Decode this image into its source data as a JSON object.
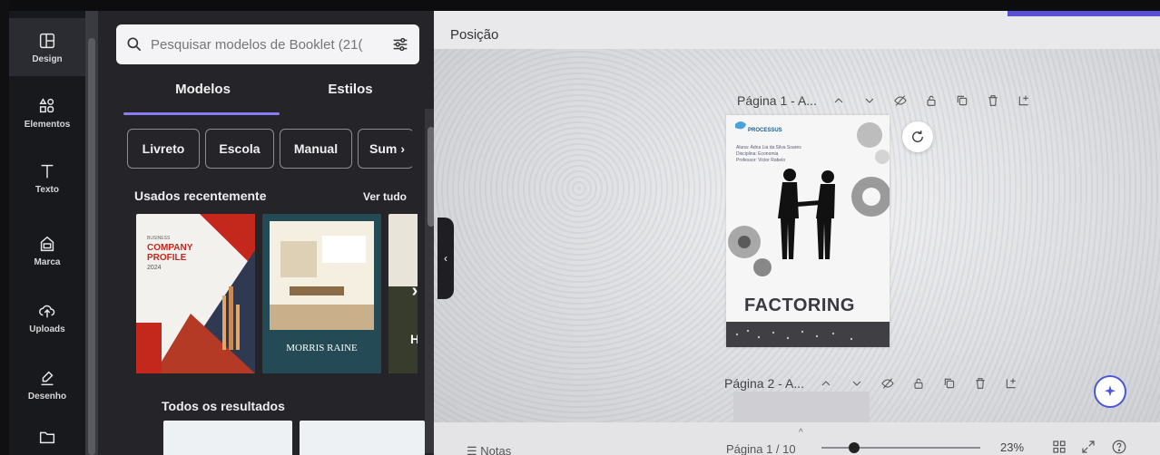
{
  "rail": {
    "items": [
      {
        "label": "Design",
        "icon": "layout-icon"
      },
      {
        "label": "Elementos",
        "icon": "shapes-icon"
      },
      {
        "label": "Texto",
        "icon": "text-icon"
      },
      {
        "label": "Marca",
        "icon": "brand-icon"
      },
      {
        "label": "Uploads",
        "icon": "upload-icon"
      },
      {
        "label": "Desenho",
        "icon": "draw-icon"
      }
    ]
  },
  "panel": {
    "search_placeholder": "Pesquisar modelos de Booklet (21(",
    "tabs": [
      "Modelos",
      "Estilos"
    ],
    "chips": [
      "Livreto",
      "Escola",
      "Manual",
      "Sum"
    ],
    "recent_title": "Usados recentemente",
    "see_all": "Ver tudo",
    "all_results_title": "Todos os resultados",
    "cards": {
      "c1_brand": "BUSINESS",
      "c1_title1": "COMPANY",
      "c1_title2": "PROFILE",
      "c1_year": "2024",
      "c2_title": "MORRIS RAINE",
      "c3_letter": "H"
    }
  },
  "canvas": {
    "position_label": "Posição",
    "page1_title": "Página 1 - A...",
    "page2_title": "Página 2 - A...",
    "page1": {
      "logo": "PROCESSUS",
      "student": "Aluna: Ádna Lia da Silva Soares",
      "discipline": "Disciplina: Economia",
      "professor": "Professor: Victor Rabelo",
      "headline": "FACTORING"
    },
    "notes": "Notas",
    "pager": "Página 1 / 10",
    "zoom": "23%",
    "zoom_level": 0.23
  }
}
